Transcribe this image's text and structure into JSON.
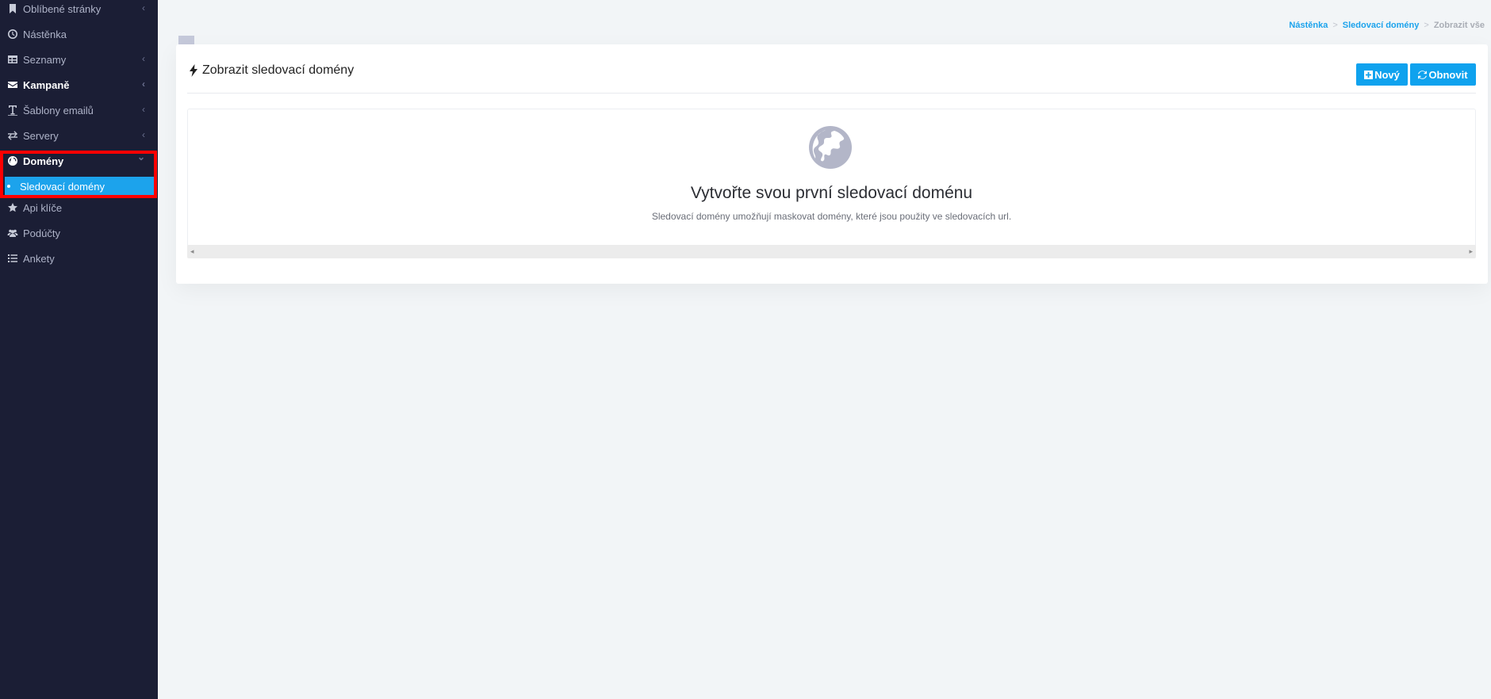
{
  "sidebar": {
    "items": [
      {
        "label": "Oblíbené stránky",
        "icon": "bookmark-icon",
        "has_chevron": true
      },
      {
        "label": "Nástěnka",
        "icon": "clock-icon",
        "has_chevron": false
      },
      {
        "label": "Seznamy",
        "icon": "table-icon",
        "has_chevron": true
      },
      {
        "label": "Kampaně",
        "icon": "envelope-icon",
        "has_chevron": true
      },
      {
        "label": "Šablony emailů",
        "icon": "text-icon",
        "has_chevron": true
      },
      {
        "label": "Servery",
        "icon": "exchange-icon",
        "has_chevron": true
      },
      {
        "label": "Domény",
        "icon": "globe-icon",
        "has_chevron": true,
        "expanded": true
      },
      {
        "label": "Api klíče",
        "icon": "star-icon",
        "has_chevron": false
      },
      {
        "label": "Podúčty",
        "icon": "users-icon",
        "has_chevron": false
      },
      {
        "label": "Ankety",
        "icon": "list-icon",
        "has_chevron": false
      }
    ],
    "subitems": [
      {
        "label": "Sledovací domény",
        "active": true
      }
    ],
    "chevron_left": "‹",
    "chevron_down": "⌄"
  },
  "breadcrumb": {
    "items": [
      "Nástěnka",
      "Sledovací domény"
    ],
    "current": "Zobrazit vše",
    "separator": ">"
  },
  "card": {
    "title": "Zobrazit sledovací domény",
    "buttons": {
      "new_label": "Nový",
      "refresh_label": "Obnovit"
    },
    "empty_state": {
      "title": "Vytvořte svou první sledovací doménu",
      "description": "Sledovací domény umožňují maskovat domény, které jsou použity ve sledovacích url.",
      "icon": "globe-icon"
    }
  },
  "colors": {
    "sidebar_bg": "#1b1e35",
    "accent": "#1ca3ec",
    "button": "#0fa2ee",
    "highlight_border": "#ff0000"
  }
}
